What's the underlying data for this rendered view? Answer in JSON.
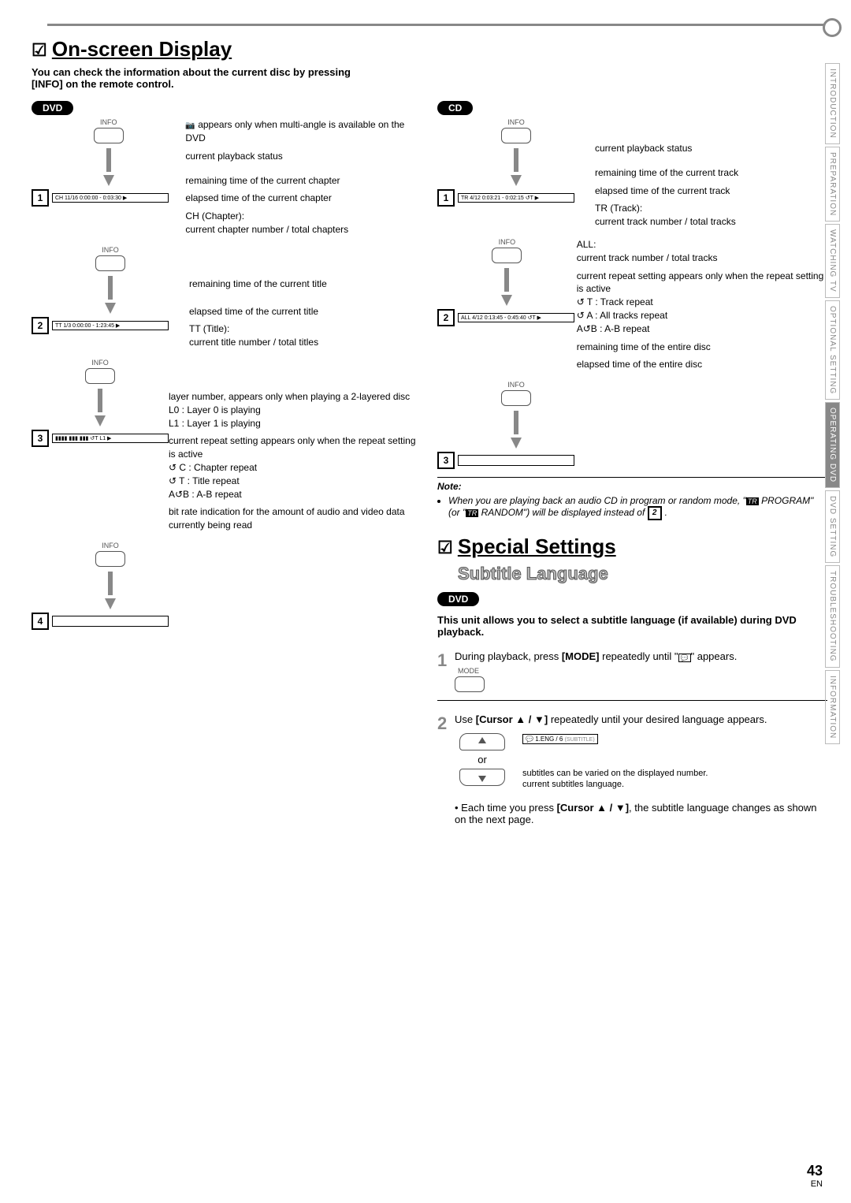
{
  "sideTabs": {
    "t0": "INTRODUCTION",
    "t1": "PREPARATION",
    "t2": "WATCHING TV",
    "t3": "OPTIONAL SETTING",
    "t4": "OPERATING DVD",
    "t5": "DVD SETTING",
    "t6": "TROUBLESHOOTING",
    "t7": "INFORMATION"
  },
  "section1": {
    "title": "On-screen Display",
    "intro_pre": "You can check the information about the current disc by pressing ",
    "intro_key": "[INFO]",
    "intro_post": " on the remote control."
  },
  "dvd": {
    "badge": "DVD",
    "info_label": "INFO",
    "bar1": "CH 11/16  0:00:00 - 0:03:30  ▶",
    "bar2": "TT 1/3  0:00:00 - 1:23:45  ▶",
    "bar3": "▮▮▮▮ ▮▮▮ ▮▮▮  ↺T  L1  ▶",
    "d1a_pre": "",
    "d1a_icon": "📷",
    "d1a_post": " appears only when multi-angle is available on the DVD",
    "d1b": "current playback status",
    "d1c": "remaining time of the current chapter",
    "d1d": "elapsed time of the current chapter",
    "d1e": "CH (Chapter):",
    "d1e2": "current chapter number / total chapters",
    "d2a": "remaining time of the current title",
    "d2b": "elapsed time of the current title",
    "d2c": "TT (Title):",
    "d2c2": "current title number / total titles",
    "d3a": "layer number, appears only when playing a 2-layered disc",
    "d3a_l0": "L0 :  Layer 0 is playing",
    "d3a_l1": "L1 :  Layer 1 is playing",
    "d3b": "current repeat setting appears only when the repeat setting is active",
    "d3b_c": "↺ C :  Chapter repeat",
    "d3b_t": "↺ T :  Title repeat",
    "d3b_ab": "A↺B :  A-B repeat",
    "d3c": "bit rate indication for the amount of audio and video data currently being read"
  },
  "cd": {
    "badge": "CD",
    "info_label": "INFO",
    "bar1": "TR 4/12  0:03:21 - 0:02:15  ↺T  ▶",
    "bar2": "ALL 4/12  0:13:45 - 0:45:40  ↺T  ▶",
    "c1a": "current playback status",
    "c1b": "remaining time of the current track",
    "c1c": "elapsed time of the current track",
    "c1d": "TR (Track):",
    "c1d2": "current track number / total tracks",
    "c2a": "ALL:",
    "c2a2": "current track number / total tracks",
    "c2b": "current repeat setting appears only when the repeat setting is active",
    "c2b_t": "↺ T :  Track repeat",
    "c2b_a": "↺ A :  All tracks repeat",
    "c2b_ab": "A↺B :  A-B repeat",
    "c2c": "remaining time of the entire disc",
    "c2d": "elapsed time of the entire disc"
  },
  "note": {
    "hdr": "Note:",
    "li1_a": "When you are playing back an audio CD in program or random mode, \"",
    "li1_tr": "TR",
    "li1_b": " PROGRAM\" (or \"",
    "li1_c": " RANDOM\") will be displayed instead of ",
    "li1_box": "2",
    "li1_d": "."
  },
  "section2": {
    "title": "Special Settings",
    "subtitle": "Subtitle Language",
    "badge": "DVD",
    "body": "This unit allows you to select a subtitle language (if available) during DVD playback.",
    "step1_a": "During playback, press ",
    "step1_key": "[MODE]",
    "step1_b": " repeatedly until \"",
    "step1_icon": "💬",
    "step1_c": "\" appears.",
    "mode_label": "MODE",
    "step2_a": "Use ",
    "step2_key": "[Cursor ▲ / ▼]",
    "step2_b": " repeatedly until your desired language appears.",
    "or": "or",
    "sub_bar_icon": "💬",
    "sub_bar_text": "1.ENG / 6",
    "sub_bar_suffix": "(SUBTITLE)",
    "sub_d1": "subtitles can be varied on the displayed number.",
    "sub_d2": "current subtitles language.",
    "tail_a": "Each time you press ",
    "tail_key": "[Cursor ▲ / ▼]",
    "tail_b": ", the subtitle language changes as shown on the next page."
  },
  "footer": {
    "page": "43",
    "lang": "EN"
  }
}
